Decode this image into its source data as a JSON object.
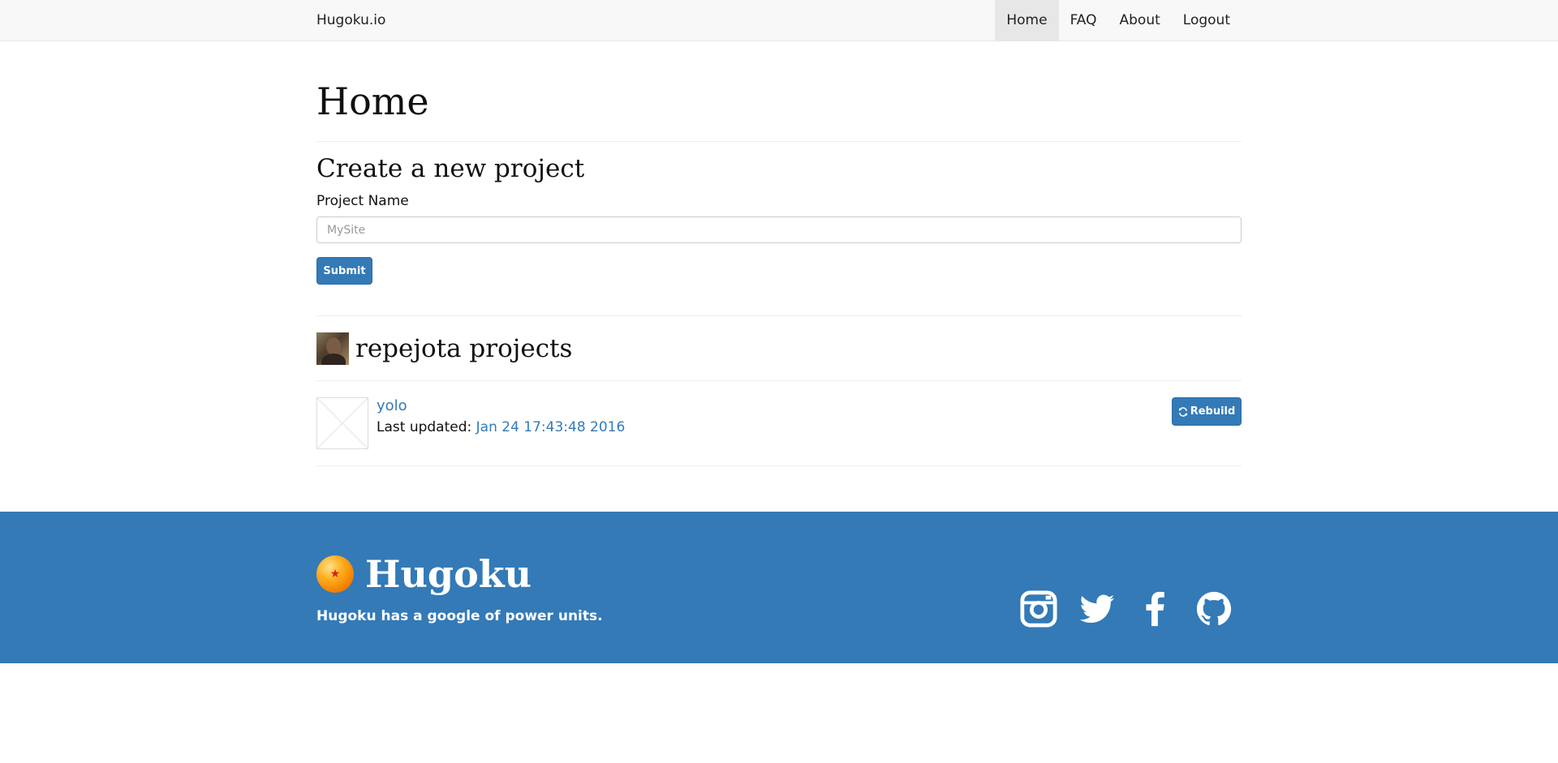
{
  "navbar": {
    "brand": "Hugoku.io",
    "items": [
      {
        "label": "Home",
        "active": true
      },
      {
        "label": "FAQ",
        "active": false
      },
      {
        "label": "About",
        "active": false
      },
      {
        "label": "Logout",
        "active": false
      }
    ]
  },
  "main": {
    "page_title": "Home",
    "create_section": {
      "title": "Create a new project",
      "field_label": "Project Name",
      "placeholder": "MySite",
      "submit_label": "Submit"
    },
    "user_projects": {
      "title": "repejota projects",
      "projects": [
        {
          "name": "yolo",
          "updated_label": "Last updated:",
          "updated_date": "Jan 24 17:43:48 2016",
          "rebuild_label": "Rebuild"
        }
      ]
    }
  },
  "footer": {
    "brand": "Hugoku",
    "tagline": "Hugoku has a google of power units.",
    "social_icons": [
      "instagram-icon",
      "twitter-icon",
      "facebook-icon",
      "github-icon"
    ]
  },
  "colors": {
    "primary": "#337ab7",
    "navbar_bg": "#f8f8f8",
    "active_nav": "#e7e7e7"
  }
}
